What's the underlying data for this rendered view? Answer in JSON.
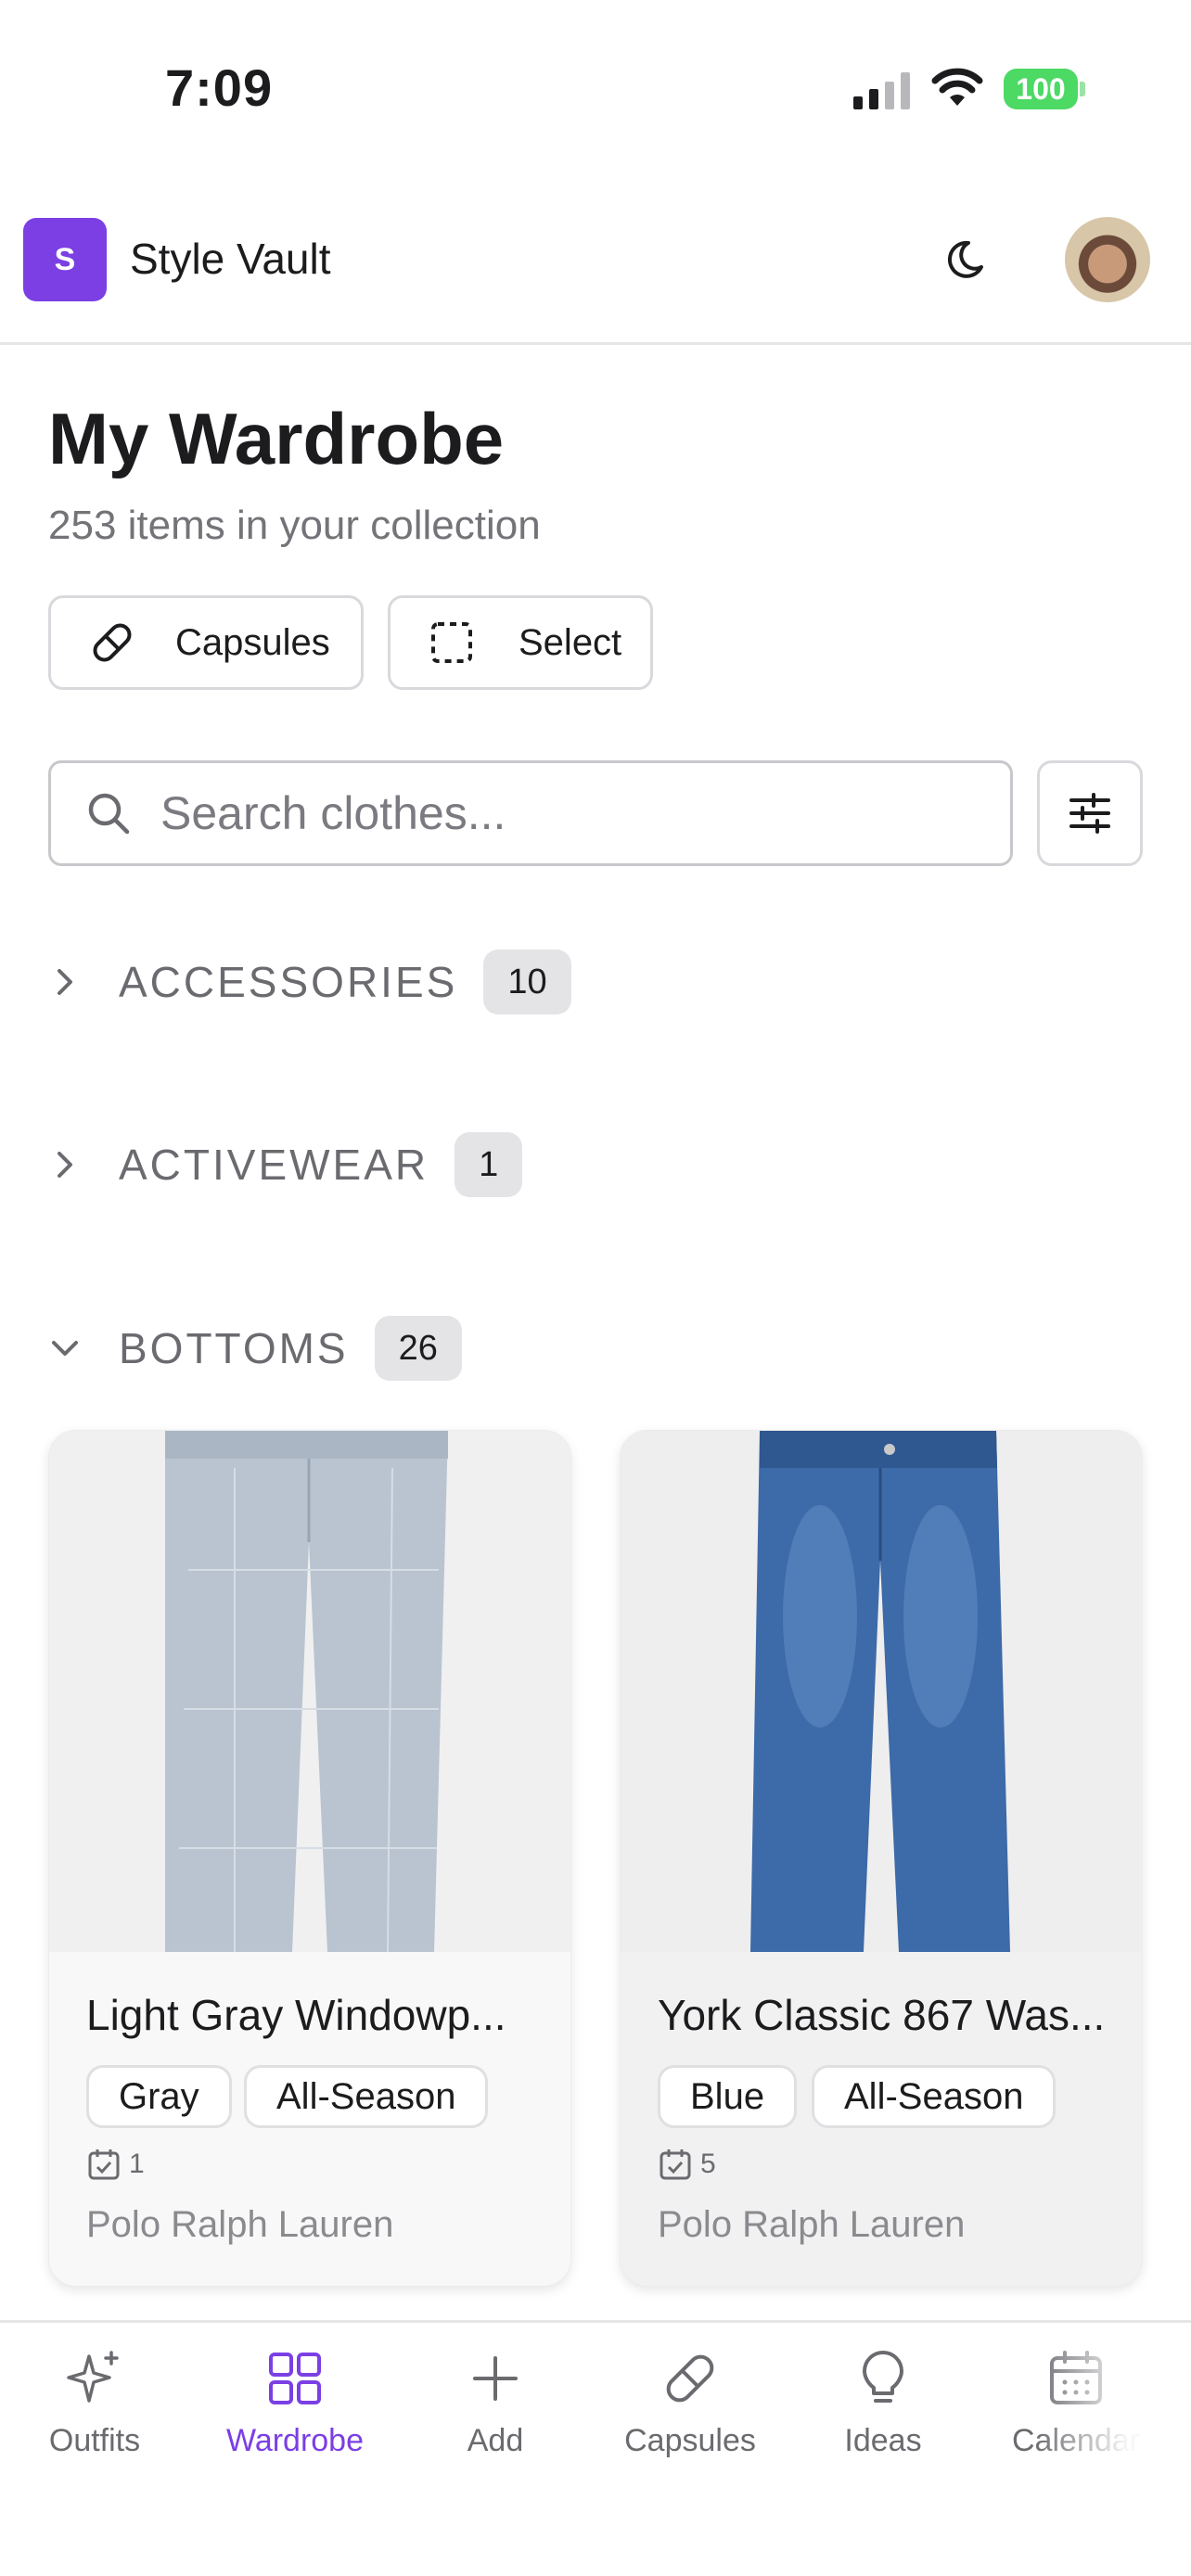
{
  "status_bar": {
    "time": "7:09",
    "battery": "100"
  },
  "header": {
    "logo_letter": "S",
    "app_title": "Style Vault"
  },
  "page": {
    "title": "My Wardrobe",
    "subtitle": "253 items in your collection"
  },
  "actions": {
    "capsules_label": "Capsules",
    "select_label": "Select"
  },
  "search": {
    "placeholder": "Search clothes...",
    "value": ""
  },
  "categories": [
    {
      "name": "ACCESSORIES",
      "count": "10",
      "expanded": false
    },
    {
      "name": "ACTIVEWEAR",
      "count": "1",
      "expanded": false
    },
    {
      "name": "BOTTOMS",
      "count": "26",
      "expanded": true
    }
  ],
  "items": [
    {
      "name": "Light Gray Windowp...",
      "tags": [
        "Gray",
        "All-Season"
      ],
      "wear_count": "1",
      "brand": "Polo Ralph Lauren"
    },
    {
      "name": "York Classic 867 Was...",
      "tags": [
        "Blue",
        "All-Season"
      ],
      "wear_count": "5",
      "brand": "Polo Ralph Lauren"
    }
  ],
  "nav": [
    {
      "label": "Outfits",
      "icon": "sparkles-icon",
      "active": false
    },
    {
      "label": "Wardrobe",
      "icon": "grid-icon",
      "active": true
    },
    {
      "label": "Add",
      "icon": "plus-icon",
      "active": false
    },
    {
      "label": "Capsules",
      "icon": "pill-icon",
      "active": false
    },
    {
      "label": "Ideas",
      "icon": "lightbulb-icon",
      "active": false
    },
    {
      "label": "Calendar",
      "icon": "calendar-icon",
      "active": false
    }
  ],
  "colors": {
    "accent": "#7b3fe4",
    "battery": "#4cd964",
    "muted_text": "#737378"
  }
}
